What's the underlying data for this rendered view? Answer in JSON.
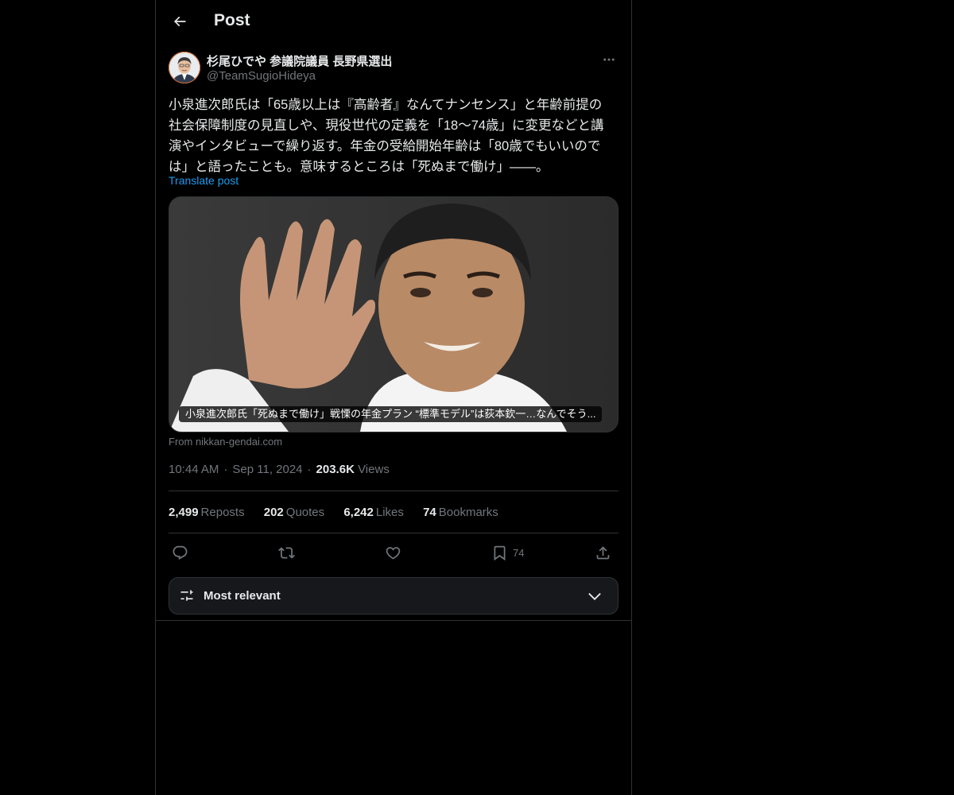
{
  "header": {
    "title": "Post"
  },
  "post": {
    "author_name": "杉尾ひでや 参議院議員 長野県選出",
    "author_handle": "@TeamSugioHideya",
    "text": "小泉進次郎氏は「65歳以上は『高齢者』なんてナンセンス」と年齢前提の\n社会保障制度の見直しや、現役世代の定義を「18〜74歳」に変更などと講\n演やインタビューで繰り返す。年金の受給開始年齢は「80歳でもいいので\nは」と語ったことも。意味するところは「死ぬまで働け」――。",
    "translate_label": "Translate post",
    "card_caption": "小泉進次郎氏「死ぬまで働け」戦慄の年金プラン “標準モデル”は荻本欽一…なんでそう...",
    "card_source": "From nikkan-gendai.com",
    "time": "10:44 AM",
    "date": "Sep 11, 2024",
    "views_count": "203.6K",
    "views_label": "Views"
  },
  "stats": {
    "reposts_count": "2,499",
    "reposts_label": "Reposts",
    "quotes_count": "202",
    "quotes_label": "Quotes",
    "likes_count": "6,242",
    "likes_label": "Likes",
    "bookmarks_count": "74",
    "bookmarks_label": "Bookmarks"
  },
  "actions": {
    "bookmark_count": "74"
  },
  "sort": {
    "label": "Most relevant"
  },
  "icons": {
    "back": "arrow-left-icon",
    "more": "more-horizontal-icon",
    "reply": "reply-icon",
    "repost": "repost-icon",
    "like": "heart-icon",
    "bookmark": "bookmark-icon",
    "share": "share-icon",
    "sort": "sliders-icon",
    "chevron": "chevron-down-icon"
  },
  "colors": {
    "background": "#000000",
    "accent": "#1d9bf0",
    "muted": "#71767b",
    "border": "#2f3336"
  }
}
